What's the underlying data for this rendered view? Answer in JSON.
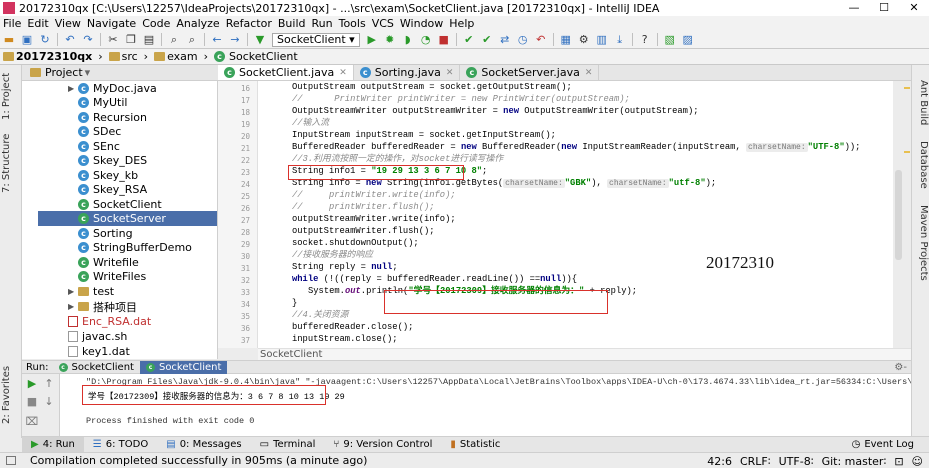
{
  "window": {
    "title": "20172310qx [C:\\Users\\12257\\IdeaProjects\\20172310qx] - ...\\src\\exam\\SocketClient.java [20172310qx] - IntelliJ IDEA",
    "minimize": "—",
    "maximize": "☐",
    "close": "✕"
  },
  "menu": [
    "File",
    "Edit",
    "View",
    "Navigate",
    "Code",
    "Analyze",
    "Refactor",
    "Build",
    "Run",
    "Tools",
    "VCS",
    "Window",
    "Help"
  ],
  "toolbar": {
    "run_config": "SocketClient"
  },
  "breadcrumb": [
    "20172310qx",
    "src",
    "exam",
    "SocketClient"
  ],
  "project_panel": {
    "title": "Project"
  },
  "side_tabs_left": [
    "1: Project",
    "7: Structure",
    "2: Favorites"
  ],
  "side_tabs_right": [
    "Ant Build",
    "Database",
    "Maven Projects"
  ],
  "tree": [
    {
      "label": "MyDoc.java",
      "kind": "class"
    },
    {
      "label": "MyUtil",
      "kind": "class"
    },
    {
      "label": "Recursion",
      "kind": "class"
    },
    {
      "label": "SDec",
      "kind": "class"
    },
    {
      "label": "SEnc",
      "kind": "class"
    },
    {
      "label": "Skey_DES",
      "kind": "class"
    },
    {
      "label": "Skey_kb",
      "kind": "class"
    },
    {
      "label": "Skey_RSA",
      "kind": "class"
    },
    {
      "label": "SocketClient",
      "kind": "main"
    },
    {
      "label": "SocketServer",
      "kind": "main",
      "selected": true
    },
    {
      "label": "Sorting",
      "kind": "class"
    },
    {
      "label": "StringBufferDemo",
      "kind": "class"
    },
    {
      "label": "Writefile",
      "kind": "main"
    },
    {
      "label": "WriteFiles",
      "kind": "main"
    },
    {
      "label": "test",
      "kind": "folder"
    },
    {
      "label": "搭种项目",
      "kind": "folder"
    },
    {
      "label": "Enc_RSA.dat",
      "kind": "datred"
    },
    {
      "label": "javac.sh",
      "kind": "file"
    },
    {
      "label": "key1.dat",
      "kind": "dat"
    }
  ],
  "editor_tabs": [
    {
      "label": "SocketClient.java",
      "active": true
    },
    {
      "label": "Sorting.java",
      "active": false
    },
    {
      "label": "SocketServer.java",
      "active": false
    }
  ],
  "line_numbers": [
    "16",
    "17",
    "18",
    "19",
    "20",
    "21",
    "22",
    "23",
    "24",
    "25",
    "26",
    "27",
    "28",
    "29",
    "30",
    "31",
    "32",
    "33",
    "34",
    "35",
    "36",
    "37"
  ],
  "code": {
    "l16": "OutputStream outputStream = socket.getOutputStream();",
    "l17": "//      PrintWriter printWriter = new PrintWriter(outputStream);",
    "l18a": "OutputStreamWriter outputStreamWriter = ",
    "l18k": "new",
    "l18b": " OutputStreamWriter(outputStream);",
    "l19": "//输入流",
    "l20": "InputStream inputStream = socket.getInputStream();",
    "l21a": "BufferedReader bufferedReader = ",
    "l21k": "new",
    "l21b": " BufferedReader(",
    "l21k2": "new",
    "l21c": " InputStreamReader(inputStream, ",
    "l21h": "charsetName:",
    "l21s": "\"UTF-8\"",
    "l21d": "));",
    "l22": "//3.利用流按照一定的操作，对socket进行读写操作",
    "l23a": "String info1 = ",
    "l23s": "\"19 29 13 3 6 7 10 8\"",
    "l23b": ";",
    "l24a": "String info = ",
    "l24k": "new",
    "l24b": " String(info1.getBytes(",
    "l24h": "charsetName:",
    "l24s": "\"GBK\"",
    "l24c": "), ",
    "l24h2": "charsetName:",
    "l24s2": "\"utf-8\"",
    "l24d": ");",
    "l25": "//     printWriter.write(info);",
    "l26": "//     printWriter.flush();",
    "l27": "outputStreamWriter.write(info);",
    "l28": "outputStreamWriter.flush();",
    "l29": "socket.shutdownOutput();",
    "l30": "//接收服务器的响应",
    "l31a": "String reply = ",
    "l31k": "null",
    "l31b": ";",
    "l32k": "while",
    "l32a": " (!((reply = bufferedReader.readLine()) ==",
    "l32k2": "null",
    "l32b": ")){",
    "l33a": "System.",
    "l33f": "out",
    "l33b": ".println(",
    "l33s": "\"学号【20172309】接收服务器的信息为：\"",
    "l33c": " + reply);",
    "l34": "}",
    "l35": "//4.关闭资源",
    "l36": "bufferedReader.close();",
    "l37": "inputStream.close();"
  },
  "watermark": "20172310",
  "editor_footer": "SocketClient",
  "run_panel": {
    "label": "Run:",
    "tabs": [
      "SocketClient",
      "SocketClient"
    ],
    "cmdline": "\"D:\\Program Files\\Java\\jdk-9.0.4\\bin\\java\" \"-javaagent:C:\\Users\\12257\\AppData\\Local\\JetBrains\\Toolbox\\apps\\IDEA-U\\ch-0\\173.4674.33\\lib\\idea_rt.jar=56334:C:\\Users\\12257\\AppData\\Local\\JetBrains\\Too",
    "output": "学号【20172309】接收服务器的信息为：3 6 7 8 10 13 19 29",
    "exit": "Process finished with exit code 0"
  },
  "bottom_tabs": [
    "4: Run",
    "6: TODO",
    "0: Messages",
    "Terminal",
    "9: Version Control",
    "Statistic"
  ],
  "event_log": "Event Log",
  "status": {
    "message": "Compilation completed successfully in 905ms (a minute ago)",
    "position": "42:6",
    "line_sep": "CRLF∶",
    "encoding": "UTF-8∶",
    "git": "Git: master∶"
  }
}
